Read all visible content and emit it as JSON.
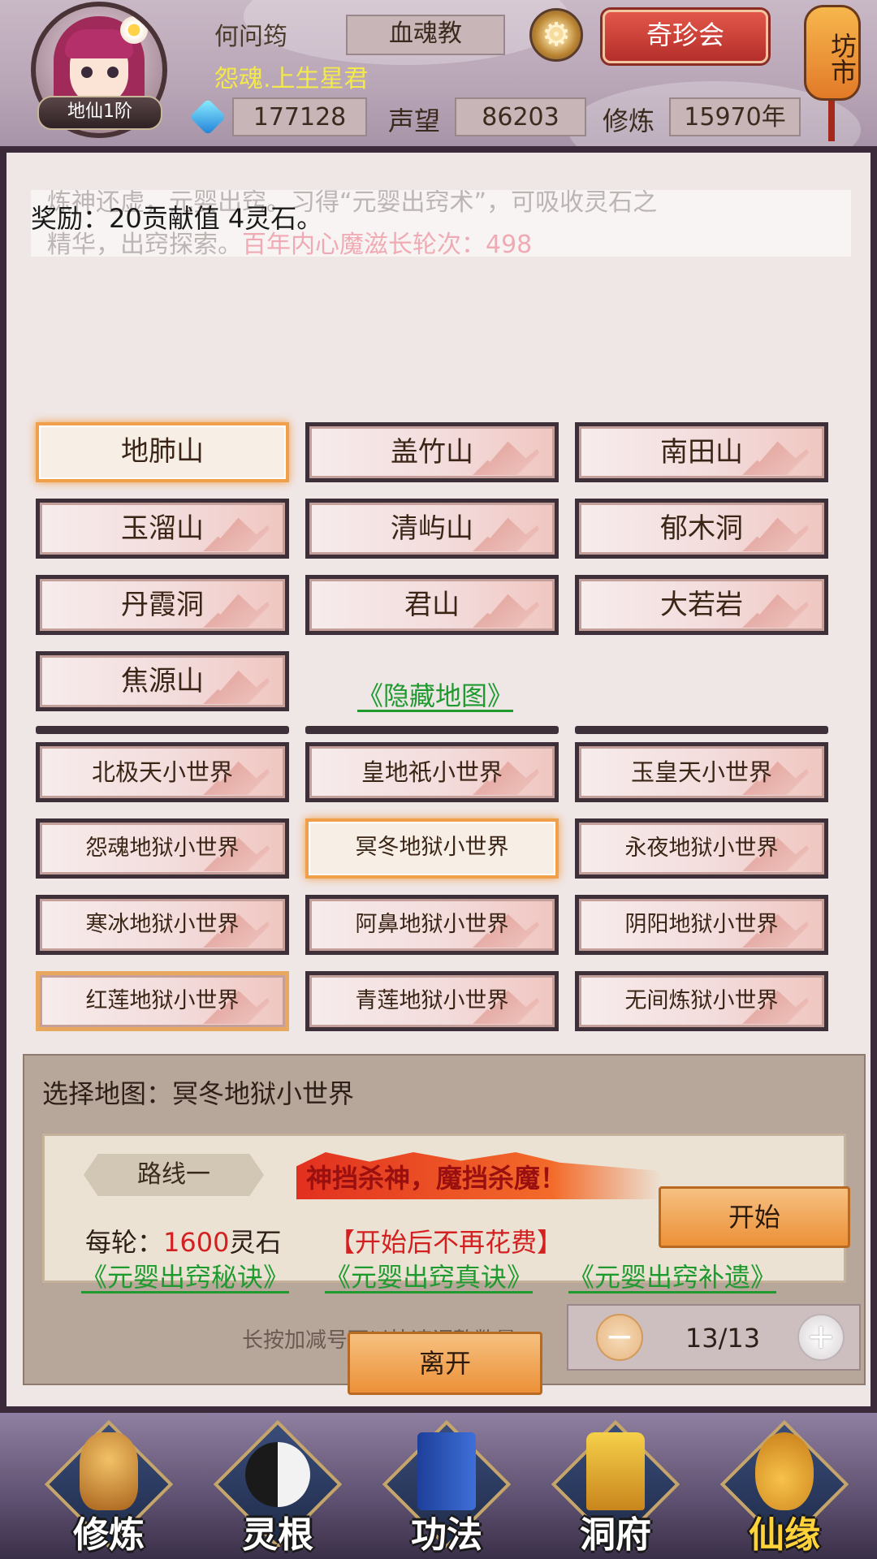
{
  "header": {
    "player_name": "何问筠",
    "player_title": "怨魂.上生星君",
    "rank": "地仙1阶",
    "sect": "血魂教",
    "treasure_label": "奇珍会",
    "market_label": "坊市",
    "spirit_stones": "177128",
    "reputation_label": "声望",
    "reputation_value": "86203",
    "cultivation_label": "修炼",
    "cultivation_value": "15970年"
  },
  "description": {
    "line1": "炼神还虚，元婴出窍。习得“元婴出窍术”，可吸收灵石之",
    "line2_prefix": "精华，出窍探索。",
    "line2_red": "百年内心魔滋长轮次：498",
    "reward": "奖励：20贡献值 4灵石。"
  },
  "maps_normal": [
    {
      "label": "地肺山",
      "selected": true
    },
    {
      "label": "盖竹山",
      "selected": false
    },
    {
      "label": "南田山",
      "selected": false
    },
    {
      "label": "玉溜山",
      "selected": false
    },
    {
      "label": "清屿山",
      "selected": false
    },
    {
      "label": "郁木洞",
      "selected": false
    },
    {
      "label": "丹霞洞",
      "selected": false
    },
    {
      "label": "君山",
      "selected": false
    },
    {
      "label": "大若岩",
      "selected": false
    },
    {
      "label": "焦源山",
      "selected": false
    }
  ],
  "hidden_map_link": "《隐藏地图》",
  "maps_world": [
    {
      "label": "北极天小世界"
    },
    {
      "label": "皇地祇小世界"
    },
    {
      "label": "玉皇天小世界"
    },
    {
      "label": "怨魂地狱小世界"
    },
    {
      "label": "冥冬地狱小世界",
      "selected": true
    },
    {
      "label": "永夜地狱小世界"
    },
    {
      "label": "寒冰地狱小世界"
    },
    {
      "label": "阿鼻地狱小世界"
    },
    {
      "label": "阴阳地狱小世界"
    },
    {
      "label": "红莲地狱小世界"
    },
    {
      "label": "青莲地狱小世界"
    },
    {
      "label": "无间炼狱小世界"
    }
  ],
  "selection": {
    "label": "选择地图：冥冬地狱小世界",
    "route_label": "路线一",
    "slogan": "神挡杀神，魔挡杀魔！",
    "cost_prefix": "每轮：",
    "cost_value": "1600",
    "cost_unit": "灵石",
    "cost_note": "【开始后不再花费】",
    "start_label": "开始",
    "hint": "长按加减号可以快速调整数量",
    "stepper_value": "13/13"
  },
  "technique_links": [
    "《元婴出窍秘诀》",
    "《元婴出窍真诀》",
    "《元婴出窍补遗》"
  ],
  "leave_label": "离开",
  "bottom_nav": [
    {
      "label": "修炼",
      "icon": "meditating-monk-icon"
    },
    {
      "label": "灵根",
      "icon": "yin-yang-sword-icon"
    },
    {
      "label": "功法",
      "icon": "scripture-book-icon"
    },
    {
      "label": "洞府",
      "icon": "pagoda-icon"
    },
    {
      "label": "仙缘",
      "icon": "gourd-icon"
    }
  ],
  "colors": {
    "accent_red": "#d32020",
    "link_green": "#1f9a2f",
    "button_orange": "#ec9138",
    "title_yellow": "#f3e94a"
  }
}
